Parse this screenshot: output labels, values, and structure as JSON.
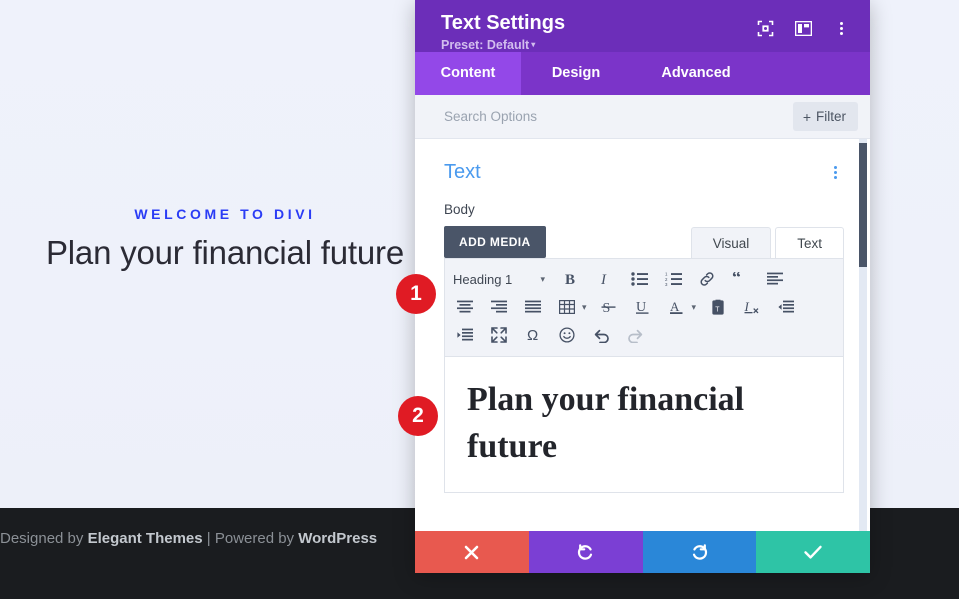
{
  "page": {
    "eyebrow": "WELCOME TO DIVI",
    "hero_title": "Plan your financial future",
    "footer_prefix": "Designed by ",
    "footer_brand1": "Elegant Themes",
    "footer_middle": " | Powered by ",
    "footer_brand2": "WordPress",
    "accent_blue": "#2a3cf5",
    "footer_bg": "#1a1c1f"
  },
  "modal": {
    "title": "Text Settings",
    "preset_label": "Preset: Default",
    "preset_caret": "▾",
    "header_bg": "#6c2eb9",
    "icons": [
      {
        "name": "focus-target-icon"
      },
      {
        "name": "layout-panel-icon"
      },
      {
        "name": "more-vertical-icon"
      }
    ],
    "tabs": [
      {
        "label": "Content",
        "active": true
      },
      {
        "label": "Design",
        "active": false
      },
      {
        "label": "Advanced",
        "active": false
      }
    ],
    "active_tab_bg": "#9348e8",
    "tabbar_bg": "#7b34c9"
  },
  "search": {
    "placeholder": "Search Options",
    "value": "",
    "filter_label": "Filter",
    "filter_plus": "+"
  },
  "section": {
    "title": "Text",
    "title_color": "#4a9aee",
    "field_label": "Body"
  },
  "editor": {
    "add_media_label": "ADD MEDIA",
    "tabs": [
      {
        "label": "Visual",
        "active": true
      },
      {
        "label": "Text",
        "active": false
      }
    ],
    "format_value": "Heading 1",
    "format_caret": "▾",
    "content": "Plan your financial future",
    "toolbar_rows": [
      [
        {
          "name": "format-select",
          "label": "Heading 1"
        },
        {
          "name": "bold-icon",
          "label": "B"
        },
        {
          "name": "italic-icon",
          "label": "I"
        },
        {
          "name": "bulleted-list-icon",
          "label": "Bulleted list"
        },
        {
          "name": "numbered-list-icon",
          "label": "Numbered list"
        },
        {
          "name": "link-icon",
          "label": "Insert link"
        },
        {
          "name": "blockquote-icon",
          "label": "Blockquote"
        },
        {
          "name": "align-left-icon",
          "label": "Align left"
        }
      ],
      [
        {
          "name": "align-center-icon",
          "label": "Align center"
        },
        {
          "name": "align-right-icon",
          "label": "Align right"
        },
        {
          "name": "align-justify-icon",
          "label": "Justify"
        },
        {
          "name": "table-icon",
          "label": "Table"
        },
        {
          "name": "strikethrough-icon",
          "label": "Strikethrough"
        },
        {
          "name": "underline-icon",
          "label": "Underline"
        },
        {
          "name": "text-color-icon",
          "label": "Text color"
        },
        {
          "name": "paste-as-text-icon",
          "label": "Paste as text"
        },
        {
          "name": "clear-formatting-icon",
          "label": "Clear formatting"
        },
        {
          "name": "outdent-icon",
          "label": "Decrease indent"
        }
      ],
      [
        {
          "name": "indent-icon",
          "label": "Increase indent"
        },
        {
          "name": "fullscreen-icon",
          "label": "Fullscreen"
        },
        {
          "name": "special-character-icon",
          "label": "Ω"
        },
        {
          "name": "emoji-icon",
          "label": "Emoji"
        },
        {
          "name": "undo-icon",
          "label": "Undo"
        },
        {
          "name": "redo-icon",
          "label": "Redo",
          "disabled": true
        }
      ]
    ]
  },
  "actions": [
    {
      "name": "cancel-button",
      "icon": "close-icon",
      "color": "#e8594f"
    },
    {
      "name": "undo-button",
      "icon": "undo-arrow-icon",
      "color": "#7b3fd4"
    },
    {
      "name": "redo-button",
      "icon": "redo-arrow-icon",
      "color": "#2a87d8"
    },
    {
      "name": "save-button",
      "icon": "checkmark-icon",
      "color": "#2ec4a6"
    }
  ],
  "steps": [
    {
      "number": "1"
    },
    {
      "number": "2"
    }
  ]
}
